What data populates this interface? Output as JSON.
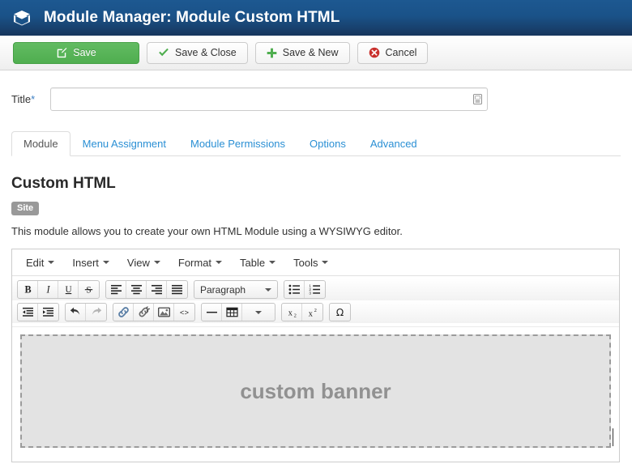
{
  "header": {
    "icon": "cube-icon",
    "title": "Module Manager: Module Custom HTML"
  },
  "toolbar": {
    "buttons": [
      {
        "label": "Save",
        "icon": "edit-square-icon",
        "style": "primary"
      },
      {
        "label": "Save & Close",
        "icon": "check-icon",
        "style": "default"
      },
      {
        "label": "Save & New",
        "icon": "plus-icon",
        "style": "default"
      },
      {
        "label": "Cancel",
        "icon": "cancel-circle-icon",
        "style": "default"
      }
    ]
  },
  "form": {
    "title_label": "Title",
    "title_required_mark": "*",
    "title_value": "",
    "title_placeholder": "",
    "title_field_icon": "form-field-icon"
  },
  "tabs": [
    {
      "label": "Module",
      "active": true
    },
    {
      "label": "Menu Assignment",
      "active": false
    },
    {
      "label": "Module Permissions",
      "active": false
    },
    {
      "label": "Options",
      "active": false
    },
    {
      "label": "Advanced",
      "active": false
    }
  ],
  "module": {
    "name": "Custom HTML",
    "badge": "Site",
    "description": "This module allows you to create your own HTML Module using a WYSIWYG editor."
  },
  "editor": {
    "menubar": [
      {
        "label": "Edit"
      },
      {
        "label": "Insert"
      },
      {
        "label": "View"
      },
      {
        "label": "Format"
      },
      {
        "label": "Table"
      },
      {
        "label": "Tools"
      }
    ],
    "toolbar_row1": [
      {
        "group": [
          {
            "icon": "bold-icon",
            "title": "Bold"
          },
          {
            "icon": "italic-icon",
            "title": "Italic"
          },
          {
            "icon": "underline-icon",
            "title": "Underline"
          },
          {
            "icon": "strikethrough-icon",
            "title": "Strikethrough"
          }
        ]
      },
      {
        "group": [
          {
            "icon": "align-left-icon",
            "title": "Align left"
          },
          {
            "icon": "align-center-icon",
            "title": "Align center"
          },
          {
            "icon": "align-right-icon",
            "title": "Align right"
          },
          {
            "icon": "align-justify-icon",
            "title": "Justify"
          }
        ]
      },
      {
        "select": {
          "value": "Paragraph",
          "icon": "chevron-down-icon"
        }
      },
      {
        "group": [
          {
            "icon": "bullet-list-icon",
            "title": "Bullet list"
          },
          {
            "icon": "numbered-list-icon",
            "title": "Numbered list"
          }
        ]
      }
    ],
    "toolbar_row2": [
      {
        "group": [
          {
            "icon": "outdent-icon",
            "title": "Decrease indent"
          },
          {
            "icon": "indent-icon",
            "title": "Increase indent"
          }
        ]
      },
      {
        "group": [
          {
            "icon": "undo-icon",
            "title": "Undo"
          },
          {
            "icon": "redo-icon",
            "title": "Redo"
          }
        ]
      },
      {
        "group": [
          {
            "icon": "link-icon",
            "title": "Insert/edit link"
          },
          {
            "icon": "unlink-icon",
            "title": "Remove link"
          },
          {
            "icon": "image-icon",
            "title": "Insert/edit image"
          },
          {
            "icon": "source-code-icon",
            "title": "Source code"
          }
        ]
      },
      {
        "group": [
          {
            "icon": "horizontal-rule-icon",
            "title": "Horizontal line"
          },
          {
            "icon": "table-icon",
            "title": "Table"
          },
          {
            "icon": "chevron-down-icon",
            "title": "Table options"
          }
        ]
      },
      {
        "group": [
          {
            "icon": "subscript-icon",
            "title": "Subscript"
          },
          {
            "icon": "superscript-icon",
            "title": "Superscript"
          }
        ]
      },
      {
        "group": [
          {
            "icon": "omega-icon",
            "title": "Special character"
          }
        ]
      }
    ],
    "content": {
      "banner_text": "custom banner"
    }
  },
  "colors": {
    "header_top": "#1d5891",
    "header_bottom": "#17365d",
    "save_green": "#4fae4f",
    "tab_link": "#2a8fd4",
    "badge_gray": "#999999",
    "cancel_red": "#c9302c",
    "banner_fill": "#e3e3e3",
    "banner_border": "#9b9b9b"
  }
}
